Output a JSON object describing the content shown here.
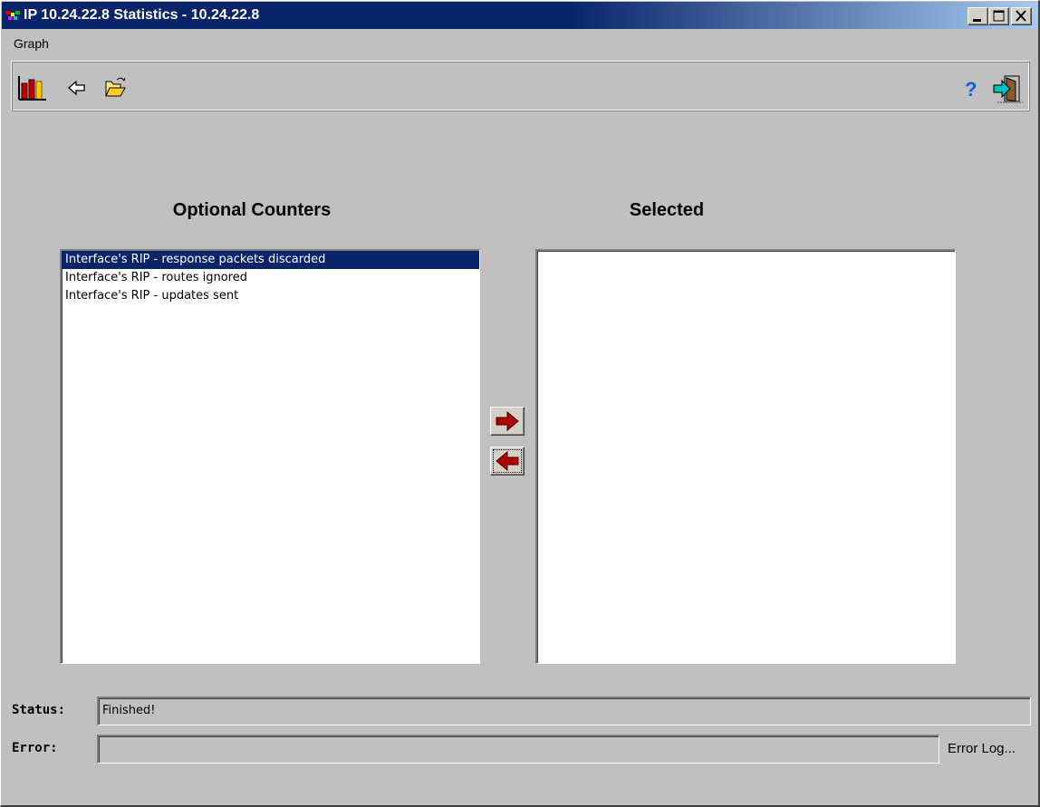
{
  "window": {
    "title": "IP 10.24.22.8 Statistics - 10.24.22.8"
  },
  "menu": {
    "items": [
      "Graph"
    ]
  },
  "toolbar": {
    "left_icons": [
      "bar-chart-icon",
      "back-arrow-icon",
      "open-folder-icon"
    ],
    "right_icons": [
      "help-icon",
      "exit-icon"
    ]
  },
  "optional_counters": {
    "heading": "Optional Counters",
    "items": [
      "Interface's RIP - response packets discarded",
      "Interface's RIP - routes ignored",
      "Interface's RIP - updates sent"
    ],
    "selected_index": 0
  },
  "selected": {
    "heading": "Selected",
    "items": []
  },
  "status": {
    "label": "Status:",
    "value": "Finished!"
  },
  "error": {
    "label": "Error:",
    "value": "",
    "log_link": "Error Log..."
  },
  "colors": {
    "titlebar": "#0a246a",
    "selection": "#0a246a",
    "arrow": "#a00000",
    "chrome": "#c0c0c0"
  }
}
